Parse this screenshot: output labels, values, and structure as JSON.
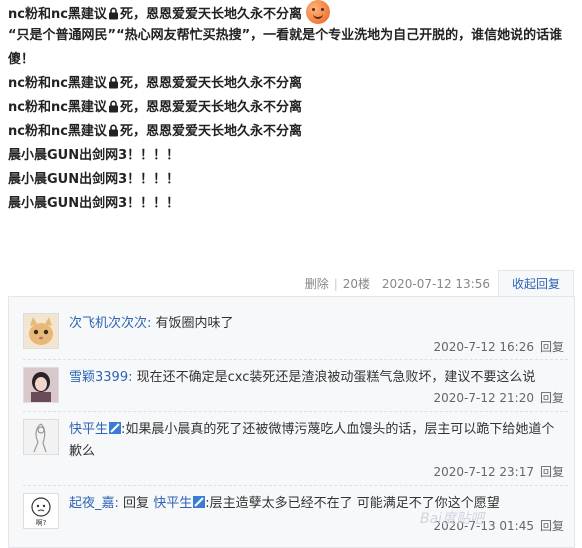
{
  "post": {
    "lines": [
      {
        "before": "nc粉和nc黑建议",
        "after": "死，恩恩爱爱天长地久永不分离"
      },
      {
        "text": "“只是个普通网民”“热心网友帮忙买热搜”，一看就是个专业洗地为自己开脱的，谁信她说的话谁傻！"
      },
      {
        "before": "nc粉和nc黑建议",
        "after": "死，恩恩爱爱天长地久永不分离"
      },
      {
        "before": "nc粉和nc黑建议",
        "after": "死，恩恩爱爱天长地久永不分离"
      },
      {
        "before": "nc粉和nc黑建议",
        "after": "死，恩恩爱爱天长地久永不分离"
      },
      {
        "text": "晨小晨GUN出剑网3！！！！"
      },
      {
        "text": "晨小晨GUN出剑网3！！！！"
      },
      {
        "text": "晨小晨GUN出剑网3！！！！"
      }
    ],
    "emoji": "smile-emoji"
  },
  "meta": {
    "delete_label": "删除",
    "floor": "20楼",
    "timestamp": "2020-07-12 13:56",
    "collapse_label": "收起回复"
  },
  "replies": [
    {
      "username": "次飞机次次次:",
      "content": "有饭圈内味了",
      "time": "2020-7-12 16:26",
      "reply_label": "回复",
      "avatar_color": "#e8c89a"
    },
    {
      "username": "雪颖3399:",
      "content": "现在还不确定是cxc装死还是渣浪被动蛋糕气急败坏，建议不要这么说",
      "time": "2020-7-12 21:20",
      "reply_label": "回复",
      "avatar_color": "#c9b0b8"
    },
    {
      "username": "快平生",
      "content": ":如果晨小晨真的死了还被微博污蔑吃人血馒头的话，层主可以跪下给她道个歉么",
      "time": "2020-7-12 23:17",
      "reply_label": "回复",
      "avatar_color": "#e9e9e9"
    },
    {
      "username": "起夜_嘉:",
      "reply_word": "回复",
      "target": "快平生",
      "content": ":层主造孽太多已经不在了 可能满足不了你这个愿望",
      "time": "2020-7-13 01:45",
      "reply_label": "回复",
      "avatar_text": "啊?",
      "avatar_color": "#ffffff"
    }
  ],
  "watermark": "Bai度贴吧",
  "colors": {
    "link": "#2d64b3",
    "lzl_bg": "#f7f8fa",
    "border": "#e4e6eb"
  }
}
